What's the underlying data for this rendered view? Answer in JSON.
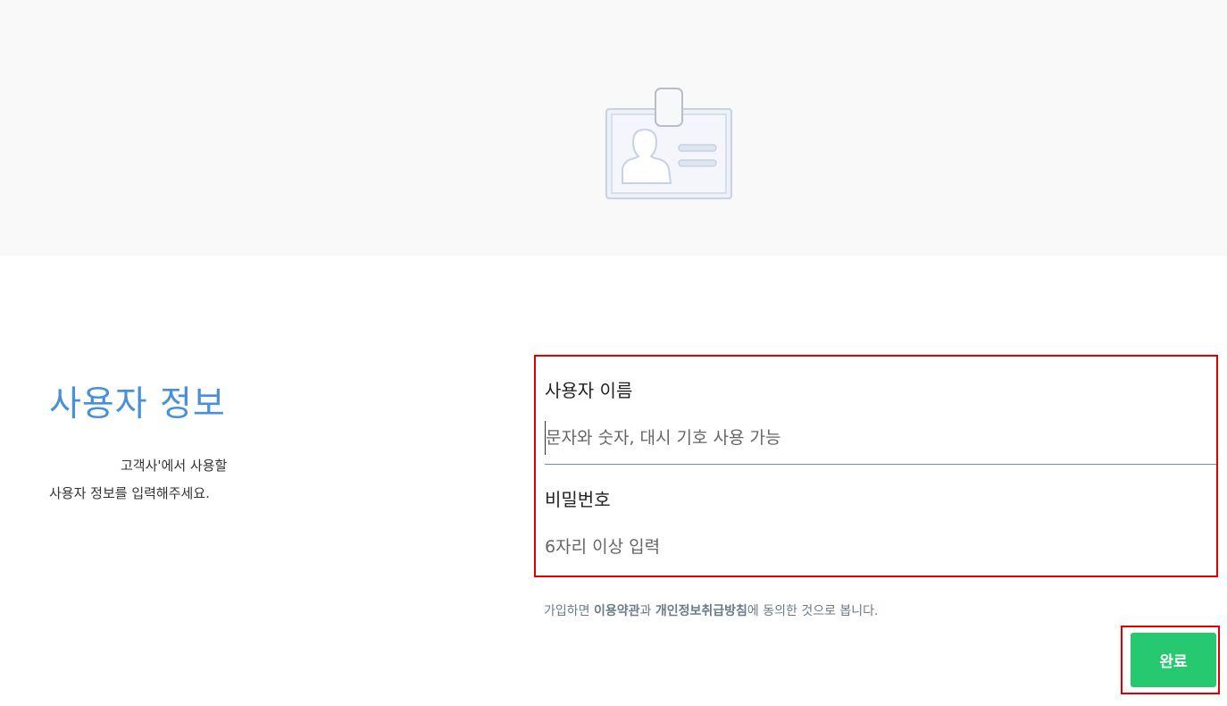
{
  "hero": {
    "icon": "id-card-icon",
    "background": "#f9f9f9"
  },
  "intro": {
    "title": "사용자 정보",
    "desc_line1": "고객사'에서 사용할",
    "desc_line2": "사용자 정보를 입력해주세요."
  },
  "form": {
    "username_label": "사용자 이름",
    "username_placeholder": "문자와 숫자, 대시 기호 사용 가능",
    "username_value": "",
    "password_label": "비밀번호",
    "password_placeholder": "6자리 이상 입력",
    "password_value": ""
  },
  "terms": {
    "prefix": "가입하면 ",
    "tos_link": "이용약관",
    "middle": "과 ",
    "privacy_link": "개인정보취급방침",
    "suffix": "에 동의한 것으로 봅니다."
  },
  "submit": {
    "label": "완료"
  },
  "colors": {
    "accent_title": "#4a90d9",
    "submit": "#26c96f",
    "highlight_border": "#e00000"
  }
}
